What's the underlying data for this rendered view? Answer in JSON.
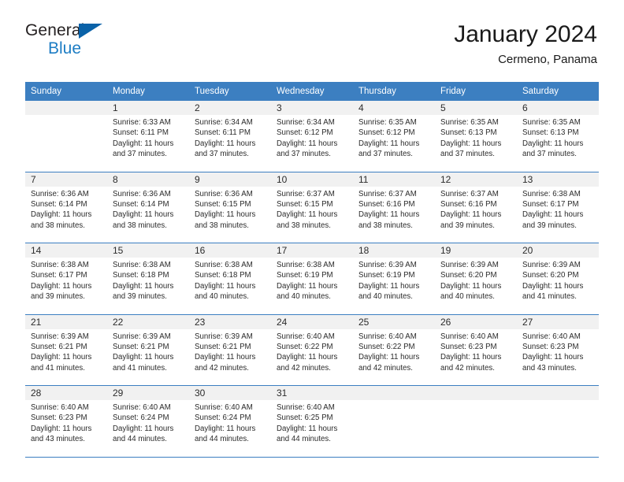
{
  "brand": {
    "name_top": "General",
    "name_bottom": "Blue",
    "accent_color": "#1d7dc4",
    "triangle_color": "#0a62a8"
  },
  "header": {
    "title": "January 2024",
    "location": "Cermeno, Panama",
    "header_bg": "#3c7fc1",
    "daynum_bg": "#f1f1f1"
  },
  "weekdays": [
    "Sunday",
    "Monday",
    "Tuesday",
    "Wednesday",
    "Thursday",
    "Friday",
    "Saturday"
  ],
  "weeks": [
    {
      "days": [
        {
          "num": "",
          "lines": []
        },
        {
          "num": "1",
          "lines": [
            "Sunrise: 6:33 AM",
            "Sunset: 6:11 PM",
            "Daylight: 11 hours",
            "and 37 minutes."
          ]
        },
        {
          "num": "2",
          "lines": [
            "Sunrise: 6:34 AM",
            "Sunset: 6:11 PM",
            "Daylight: 11 hours",
            "and 37 minutes."
          ]
        },
        {
          "num": "3",
          "lines": [
            "Sunrise: 6:34 AM",
            "Sunset: 6:12 PM",
            "Daylight: 11 hours",
            "and 37 minutes."
          ]
        },
        {
          "num": "4",
          "lines": [
            "Sunrise: 6:35 AM",
            "Sunset: 6:12 PM",
            "Daylight: 11 hours",
            "and 37 minutes."
          ]
        },
        {
          "num": "5",
          "lines": [
            "Sunrise: 6:35 AM",
            "Sunset: 6:13 PM",
            "Daylight: 11 hours",
            "and 37 minutes."
          ]
        },
        {
          "num": "6",
          "lines": [
            "Sunrise: 6:35 AM",
            "Sunset: 6:13 PM",
            "Daylight: 11 hours",
            "and 37 minutes."
          ]
        }
      ]
    },
    {
      "days": [
        {
          "num": "7",
          "lines": [
            "Sunrise: 6:36 AM",
            "Sunset: 6:14 PM",
            "Daylight: 11 hours",
            "and 38 minutes."
          ]
        },
        {
          "num": "8",
          "lines": [
            "Sunrise: 6:36 AM",
            "Sunset: 6:14 PM",
            "Daylight: 11 hours",
            "and 38 minutes."
          ]
        },
        {
          "num": "9",
          "lines": [
            "Sunrise: 6:36 AM",
            "Sunset: 6:15 PM",
            "Daylight: 11 hours",
            "and 38 minutes."
          ]
        },
        {
          "num": "10",
          "lines": [
            "Sunrise: 6:37 AM",
            "Sunset: 6:15 PM",
            "Daylight: 11 hours",
            "and 38 minutes."
          ]
        },
        {
          "num": "11",
          "lines": [
            "Sunrise: 6:37 AM",
            "Sunset: 6:16 PM",
            "Daylight: 11 hours",
            "and 38 minutes."
          ]
        },
        {
          "num": "12",
          "lines": [
            "Sunrise: 6:37 AM",
            "Sunset: 6:16 PM",
            "Daylight: 11 hours",
            "and 39 minutes."
          ]
        },
        {
          "num": "13",
          "lines": [
            "Sunrise: 6:38 AM",
            "Sunset: 6:17 PM",
            "Daylight: 11 hours",
            "and 39 minutes."
          ]
        }
      ]
    },
    {
      "days": [
        {
          "num": "14",
          "lines": [
            "Sunrise: 6:38 AM",
            "Sunset: 6:17 PM",
            "Daylight: 11 hours",
            "and 39 minutes."
          ]
        },
        {
          "num": "15",
          "lines": [
            "Sunrise: 6:38 AM",
            "Sunset: 6:18 PM",
            "Daylight: 11 hours",
            "and 39 minutes."
          ]
        },
        {
          "num": "16",
          "lines": [
            "Sunrise: 6:38 AM",
            "Sunset: 6:18 PM",
            "Daylight: 11 hours",
            "and 40 minutes."
          ]
        },
        {
          "num": "17",
          "lines": [
            "Sunrise: 6:38 AM",
            "Sunset: 6:19 PM",
            "Daylight: 11 hours",
            "and 40 minutes."
          ]
        },
        {
          "num": "18",
          "lines": [
            "Sunrise: 6:39 AM",
            "Sunset: 6:19 PM",
            "Daylight: 11 hours",
            "and 40 minutes."
          ]
        },
        {
          "num": "19",
          "lines": [
            "Sunrise: 6:39 AM",
            "Sunset: 6:20 PM",
            "Daylight: 11 hours",
            "and 40 minutes."
          ]
        },
        {
          "num": "20",
          "lines": [
            "Sunrise: 6:39 AM",
            "Sunset: 6:20 PM",
            "Daylight: 11 hours",
            "and 41 minutes."
          ]
        }
      ]
    },
    {
      "days": [
        {
          "num": "21",
          "lines": [
            "Sunrise: 6:39 AM",
            "Sunset: 6:21 PM",
            "Daylight: 11 hours",
            "and 41 minutes."
          ]
        },
        {
          "num": "22",
          "lines": [
            "Sunrise: 6:39 AM",
            "Sunset: 6:21 PM",
            "Daylight: 11 hours",
            "and 41 minutes."
          ]
        },
        {
          "num": "23",
          "lines": [
            "Sunrise: 6:39 AM",
            "Sunset: 6:21 PM",
            "Daylight: 11 hours",
            "and 42 minutes."
          ]
        },
        {
          "num": "24",
          "lines": [
            "Sunrise: 6:40 AM",
            "Sunset: 6:22 PM",
            "Daylight: 11 hours",
            "and 42 minutes."
          ]
        },
        {
          "num": "25",
          "lines": [
            "Sunrise: 6:40 AM",
            "Sunset: 6:22 PM",
            "Daylight: 11 hours",
            "and 42 minutes."
          ]
        },
        {
          "num": "26",
          "lines": [
            "Sunrise: 6:40 AM",
            "Sunset: 6:23 PM",
            "Daylight: 11 hours",
            "and 42 minutes."
          ]
        },
        {
          "num": "27",
          "lines": [
            "Sunrise: 6:40 AM",
            "Sunset: 6:23 PM",
            "Daylight: 11 hours",
            "and 43 minutes."
          ]
        }
      ]
    },
    {
      "days": [
        {
          "num": "28",
          "lines": [
            "Sunrise: 6:40 AM",
            "Sunset: 6:23 PM",
            "Daylight: 11 hours",
            "and 43 minutes."
          ]
        },
        {
          "num": "29",
          "lines": [
            "Sunrise: 6:40 AM",
            "Sunset: 6:24 PM",
            "Daylight: 11 hours",
            "and 44 minutes."
          ]
        },
        {
          "num": "30",
          "lines": [
            "Sunrise: 6:40 AM",
            "Sunset: 6:24 PM",
            "Daylight: 11 hours",
            "and 44 minutes."
          ]
        },
        {
          "num": "31",
          "lines": [
            "Sunrise: 6:40 AM",
            "Sunset: 6:25 PM",
            "Daylight: 11 hours",
            "and 44 minutes."
          ]
        },
        {
          "num": "",
          "lines": []
        },
        {
          "num": "",
          "lines": []
        },
        {
          "num": "",
          "lines": []
        }
      ]
    }
  ]
}
